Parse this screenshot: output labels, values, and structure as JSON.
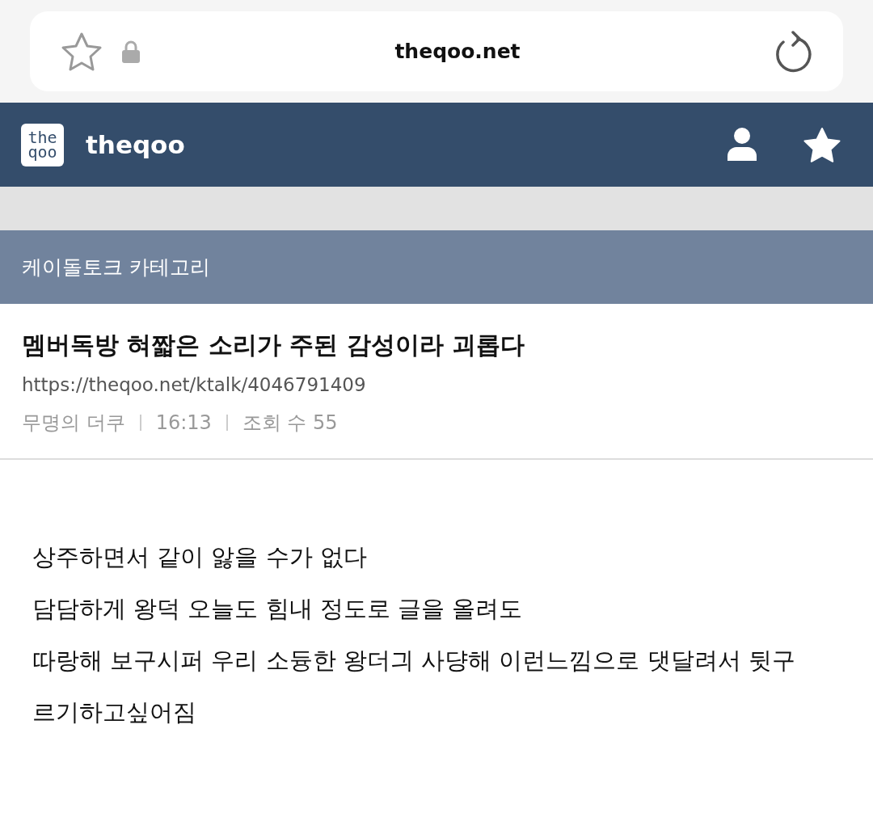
{
  "browser_bar": {
    "url": "theqoo.net"
  },
  "site_header": {
    "logo_mark": [
      "the",
      "qoo"
    ],
    "site_name": "theqoo"
  },
  "category_bar": {
    "title": "케이돌토크 카테고리"
  },
  "post": {
    "title": "멤버독방 혀짧은 소리가 주된 감성이라 괴롭다",
    "link": "https://theqoo.net/ktalk/4046791409",
    "author": "무명의 더쿠",
    "time": "16:13",
    "views": "조회 수 55",
    "body_lines": [
      "상주하면서 같이 앓을 수가 없다",
      "담담하게 왕덕 오늘도 힘내 정도로 글을 올려도",
      "따랑해 보구시퍼 우리 소듕한 왕더긔 사댱해 이런느낌으로 댓달려서 뒷구",
      "르기하고싶어짐"
    ]
  }
}
